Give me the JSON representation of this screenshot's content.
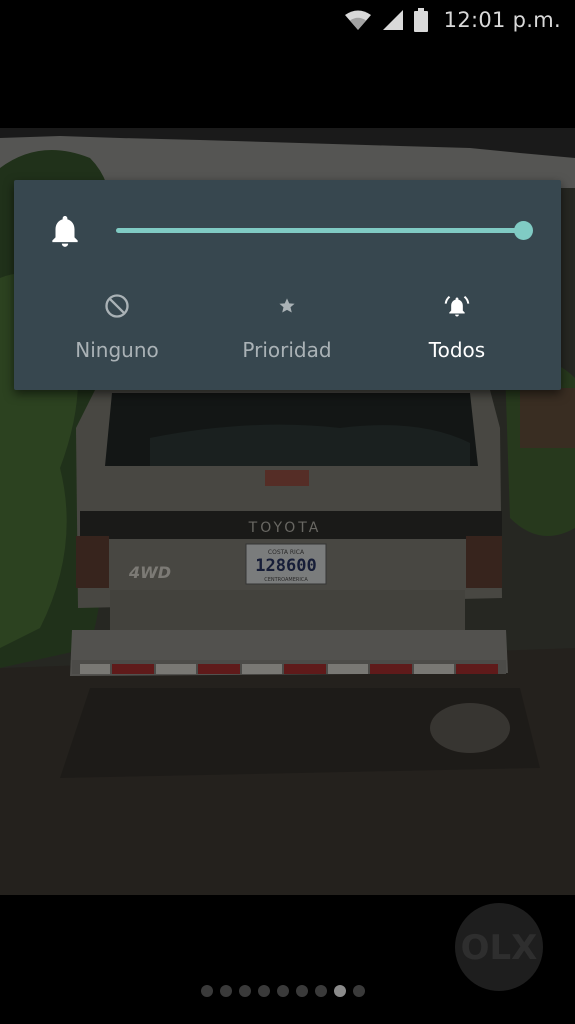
{
  "status_bar": {
    "time": "12:01 p.m.",
    "icons": [
      "wifi-icon",
      "signal-icon",
      "battery-icon"
    ]
  },
  "photo": {
    "subject": "vehicle-rear-photo",
    "plate_top": "COSTA RICA",
    "plate_number": "128600",
    "plate_bottom": "CENTROAMERICA",
    "brand": "TOYOTA",
    "badge": "4WD"
  },
  "volume_panel": {
    "icon": "bell-icon",
    "level": 1.0,
    "accent_color": "#80cbc4",
    "background_color": "#37474f",
    "modes": [
      {
        "label": "Ninguno",
        "icon": "do-not-disturb-icon",
        "active": false
      },
      {
        "label": "Prioridad",
        "icon": "star-icon",
        "active": false
      },
      {
        "label": "Todos",
        "icon": "bell-ringing-icon",
        "active": true
      }
    ]
  },
  "pager": {
    "count": 9,
    "active_index": 7
  },
  "watermark": {
    "text": "OLX"
  }
}
